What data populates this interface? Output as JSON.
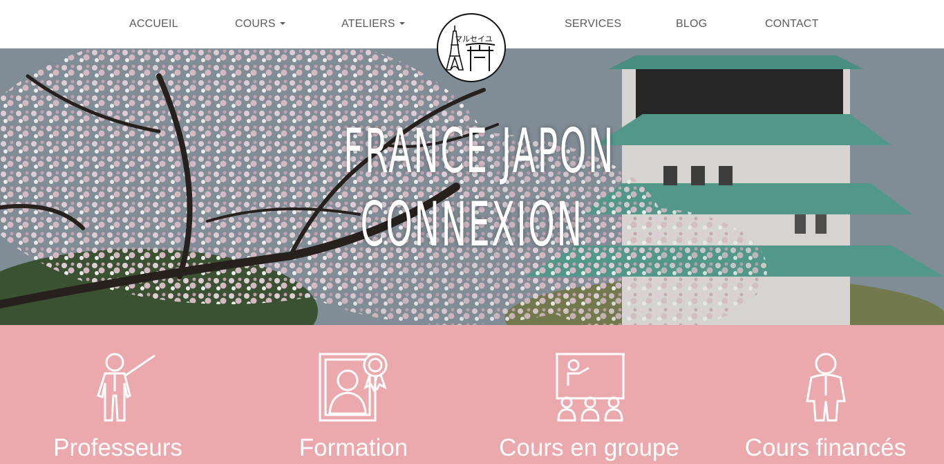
{
  "nav": {
    "items": [
      {
        "label": "ACCUEIL",
        "dropdown": false
      },
      {
        "label": "COURS",
        "dropdown": true
      },
      {
        "label": "ATELIERS",
        "dropdown": true
      },
      {
        "label": "SERVICES",
        "dropdown": false
      },
      {
        "label": "BLOG",
        "dropdown": false
      },
      {
        "label": "CONTACT",
        "dropdown": false
      }
    ],
    "logo_text": "マルセイユ"
  },
  "hero": {
    "title_line1": "FRANCE JAPON",
    "title_line2": "CONNEXION"
  },
  "features": [
    {
      "icon": "teacher-pointer-icon",
      "label": "Professeurs"
    },
    {
      "icon": "certified-trainer-icon",
      "label": "Formation"
    },
    {
      "icon": "group-class-icon",
      "label": "Cours en groupe"
    },
    {
      "icon": "business-person-icon",
      "label": "Cours financés"
    }
  ],
  "colors": {
    "features_bg": "#eca9ad",
    "nav_text": "#5b5b5b",
    "hero_text": "#ffffff"
  }
}
